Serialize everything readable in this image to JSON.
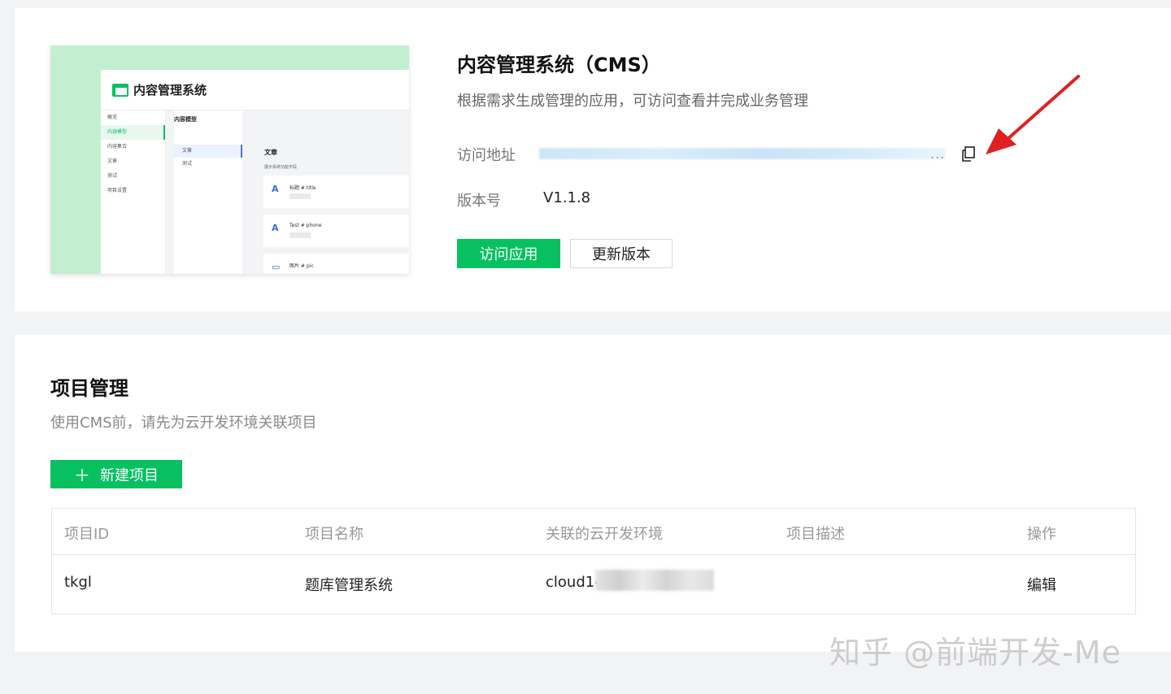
{
  "app": {
    "preview": {
      "title": "内容管理系统",
      "sidebar": [
        "概览",
        "内容模型",
        "内容集合",
        "文章",
        "测试",
        "项目设置"
      ],
      "model_heading": "内容模型",
      "models": [
        "文章",
        "测试"
      ],
      "content_heading": "文章",
      "toggle_label": "展示系统功能字段",
      "fields": [
        {
          "name": "标题 # title",
          "type": "单行字符串"
        },
        {
          "name": "Test # phone",
          "type": "单行字符串"
        },
        {
          "name": "图片 # pic",
          "type": ""
        }
      ]
    },
    "title": "内容管理系统（CMS）",
    "description": "根据需求生成管理的应用，可访问查看并完成业务管理",
    "url_label": "访问地址",
    "url_ellipsis": "...",
    "version_label": "版本号",
    "version_value": "V1.1.8",
    "visit_button": "访问应用",
    "update_button": "更新版本"
  },
  "projects": {
    "title": "项目管理",
    "description": "使用CMS前，请先为云开发环境关联项目",
    "new_button": "新建项目",
    "new_button_icon": "plus-icon",
    "columns": [
      "项目ID",
      "项目名称",
      "关联的云开发环境",
      "项目描述",
      "操作"
    ],
    "rows": [
      {
        "id": "tkgl",
        "name": "题库管理系统",
        "env": "cloud1-",
        "description": "",
        "action": "编辑"
      }
    ]
  },
  "watermark": "知乎 @前端开发-Me",
  "colors": {
    "accent": "#07c160",
    "link": "#2a8be0",
    "annotation_arrow": "#e02020"
  }
}
